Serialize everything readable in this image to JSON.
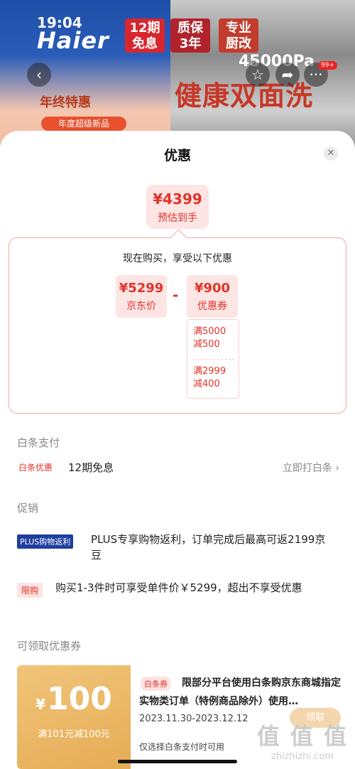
{
  "status": {
    "time": "19:04"
  },
  "background": {
    "brand": "Haier",
    "tags": [
      "12期\n免息",
      "质保\n3年",
      "专业\n厨改"
    ],
    "pa_text": "45000Pa",
    "banner": "健康双面洗",
    "year_sale": "年终特惠",
    "ribbon": "年度超级新品",
    "cart_badge": "99+"
  },
  "sheet": {
    "title": "优惠",
    "final_price": {
      "value": "¥4399",
      "label": "预估到手"
    },
    "calc": {
      "heading": "现在购买，享受以下优惠",
      "jd_price": {
        "value": "¥5299",
        "label": "京东价"
      },
      "minus": "-",
      "coupon": {
        "value": "¥900",
        "label": "优惠券"
      },
      "rules": [
        "满5000\n减500",
        "满2999\n减400"
      ]
    },
    "baitiao": {
      "section_title": "白条支付",
      "tag": "白条优惠",
      "text": "12期免息",
      "link": "立即打白条 ›"
    },
    "promo": {
      "section_title": "促销",
      "plus_tag": "PLUS购物返利",
      "plus_text": "PLUS专享购物返利，订单完成后最高可返2199京豆",
      "limit_tag": "限购",
      "limit_text": "购买1-3件时可享受单件价￥5299，超出不享受优惠"
    },
    "coupons": {
      "section_title": "可领取优惠券",
      "items": [
        {
          "currency": "¥",
          "amount": "100",
          "condition": "满101元减100元",
          "tag": "白条券",
          "description": "限部分平台使用白条购京东商城指定实物类订单（特例商品除外）使用…",
          "date": "2023.11.30-2023.12.12",
          "note": "仅选择白条支付时可用",
          "claim": "领取"
        }
      ]
    }
  },
  "watermark": {
    "big": "值 值 值",
    "small": "zhizhizhi.com"
  }
}
